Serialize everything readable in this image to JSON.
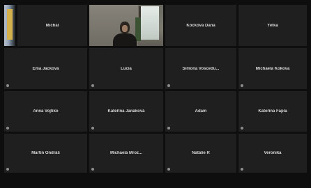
{
  "participants": [
    {
      "id": "p1",
      "name": "",
      "video": "left"
    },
    {
      "id": "p2",
      "name": "Michal",
      "video": null
    },
    {
      "id": "p3",
      "name": "",
      "video": "center"
    },
    {
      "id": "p4",
      "name": "Kocková Dana",
      "video": null
    },
    {
      "id": "p5",
      "name": "Yetka",
      "video": null
    },
    {
      "id": "p6",
      "name": "Ema Jacková",
      "video": null
    },
    {
      "id": "p7",
      "name": "Lucia",
      "video": null
    },
    {
      "id": "p8",
      "name": "Simona Voscedu...",
      "video": null
    },
    {
      "id": "p9",
      "name": "Michaela Kokova",
      "video": null
    },
    {
      "id": "p10",
      "name": "Anna Vojtíko",
      "video": null
    },
    {
      "id": "p11",
      "name": "Kateřina Janáková",
      "video": null
    },
    {
      "id": "p12",
      "name": "Adam",
      "video": null
    },
    {
      "id": "p13",
      "name": "Kateřina Fapla",
      "video": null
    },
    {
      "id": "p14",
      "name": "Martin Ondráš",
      "video": null
    },
    {
      "id": "p15",
      "name": "Michaela Mroz...",
      "video": null
    },
    {
      "id": "p16",
      "name": "Natálie R",
      "video": null
    },
    {
      "id": "p17",
      "name": "Veronika",
      "video": null
    }
  ],
  "colors": {
    "background": "#0e0e0e",
    "tile": "#1f1f1f",
    "name_text": "#d9d9d9"
  }
}
